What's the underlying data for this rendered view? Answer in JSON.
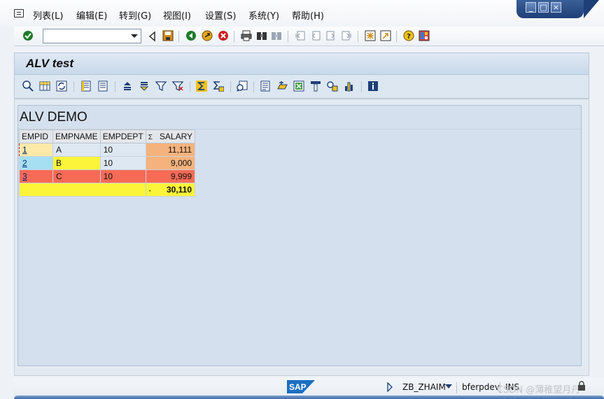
{
  "menubar": {
    "items": [
      {
        "label": "列表(L)"
      },
      {
        "label": "编辑(E)"
      },
      {
        "label": "转到(G)"
      },
      {
        "label": "视图(I)"
      },
      {
        "label": "设置(S)"
      },
      {
        "label": "系统(Y)"
      },
      {
        "label": "帮助(H)"
      }
    ]
  },
  "window_controls": {
    "minimize": "_",
    "maximize": "□",
    "close": "×"
  },
  "command_field": {
    "value": ""
  },
  "title": "ALV test",
  "alv": {
    "heading": "ALV DEMO",
    "columns": [
      "EMPID",
      "EMPNAME",
      "EMPDEPT",
      "SALARY"
    ],
    "sum_marker": "Σ",
    "rows": [
      {
        "empid": "1",
        "empname": "A",
        "empdept": "10",
        "salary": "11,111"
      },
      {
        "empid": "2",
        "empname": "B",
        "empdept": "10",
        "salary": "9,000"
      },
      {
        "empid": "3",
        "empname": "C",
        "empdept": "10",
        "salary": "9,999"
      }
    ],
    "total_marker": "▪",
    "total": "30,110"
  },
  "statusbar": {
    "logo": "SAP",
    "program": "ZB_ZHAIM",
    "server": "bferpdev",
    "mode": "INS",
    "watermark": "CSDN @薄稚望月丹"
  },
  "colors": {
    "row1_empid": "#fde9a8",
    "row1_salary": "#f5b27c",
    "row2_empid": "#a6dff2",
    "row2_empname": "#fbf43a",
    "row2_salary": "#f5b27c",
    "row3": "#f76a56",
    "total_row": "#fbf43a",
    "cell_blue": "#dde8f3"
  }
}
